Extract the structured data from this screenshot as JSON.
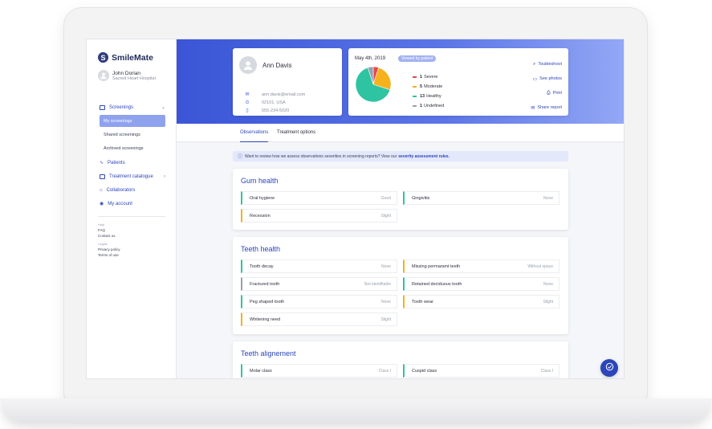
{
  "brand": {
    "name": "SmileMate",
    "mark": "S"
  },
  "user": {
    "name": "John Dorian",
    "hospital": "Sacred Heart Hospital"
  },
  "nav": {
    "screenings": "Screenings",
    "sub": [
      "My screenings",
      "Shared screenings",
      "Archived screenings"
    ],
    "patients": "Patients",
    "catalogue": "Treatment catalogue",
    "collaborators": "Collaborators",
    "account": "My account"
  },
  "footer": {
    "help_heading": "Help",
    "help_items": [
      "FAQ",
      "Contact us"
    ],
    "legals_heading": "Legals",
    "legal_items": [
      "Privacy policy",
      "Terms of use"
    ]
  },
  "patient": {
    "name": "Ann Davis",
    "email": "ann.davis@email.com",
    "address": "02101, USA",
    "phone": "555-234-5020"
  },
  "report": {
    "date": "May 4th, 2019",
    "badge": "Viewed by patient",
    "legend": [
      {
        "count": "1",
        "label": "Severe",
        "color": "#e8474b"
      },
      {
        "count": "5",
        "label": "Moderate",
        "color": "#f5b21c"
      },
      {
        "count": "13",
        "label": "Healthy",
        "color": "#2ec4a1"
      },
      {
        "count": "1",
        "label": "Undefined",
        "color": "#9aa0b0"
      }
    ],
    "actions": [
      "Toubleshoot",
      "See photos",
      "Print",
      "Share report"
    ]
  },
  "chart_data": {
    "type": "pie",
    "categories": [
      "Severe",
      "Moderate",
      "Healthy",
      "Undefined"
    ],
    "values": [
      1,
      5,
      13,
      1
    ],
    "colors": [
      "#e8474b",
      "#f5b21c",
      "#2ec4a1",
      "#9aa0b0"
    ]
  },
  "tabs": [
    "Observations",
    "Treatment options"
  ],
  "info": {
    "text": "Want to review how we assess observations severities in screening reports? View our",
    "link": "severity assessment rules."
  },
  "sections": [
    {
      "title": "Gum health",
      "items": [
        {
          "label": "Oral hygiene",
          "value": "Good",
          "color": "#2ec4a1"
        },
        {
          "label": "Gingivitis",
          "value": "None",
          "color": "#2ec4a1"
        },
        {
          "label": "Recession",
          "value": "Slight",
          "color": "#f5b21c"
        }
      ]
    },
    {
      "title": "Teeth health",
      "items": [
        {
          "label": "Tooth decay",
          "value": "None",
          "color": "#2ec4a1"
        },
        {
          "label": "Missing permanent teeth",
          "value": "Without space",
          "color": "#f5b21c"
        },
        {
          "label": "Fractured tooth",
          "value": "Not identifiable",
          "color": "#9aa0b0"
        },
        {
          "label": "Retained deciduous tooth",
          "value": "None",
          "color": "#2ec4a1"
        },
        {
          "label": "Peg shaped tooth",
          "value": "None",
          "color": "#2ec4a1"
        },
        {
          "label": "Tooth wear",
          "value": "Slight",
          "color": "#f5b21c"
        },
        {
          "label": "Whitening need",
          "value": "Slight",
          "color": "#f5b21c"
        }
      ]
    },
    {
      "title": "Teeth alignement",
      "items": [
        {
          "label": "Molar class",
          "value": "Class I",
          "color": "#2ec4a1"
        },
        {
          "label": "Cuspid class",
          "value": "Class I",
          "color": "#2ec4a1"
        }
      ]
    }
  ]
}
